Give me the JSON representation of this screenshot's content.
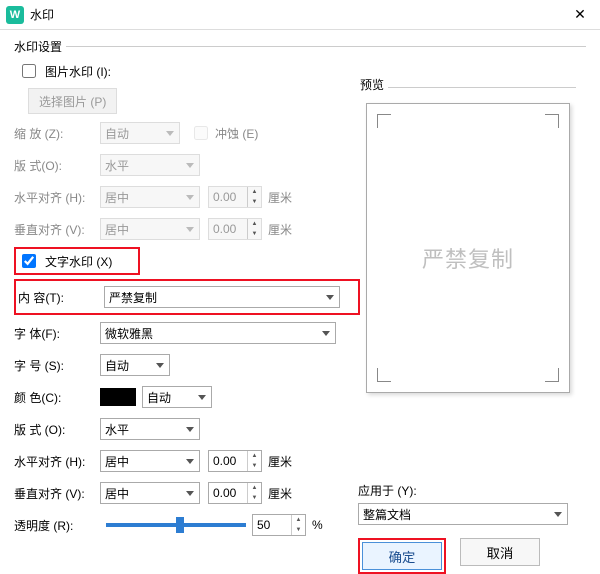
{
  "window": {
    "title": "水印",
    "close": "✕",
    "app_glyph": "W"
  },
  "settings_title": "水印设置",
  "image": {
    "checkbox_label": "图片水印 (I):",
    "select_button": "选择图片 (P)",
    "scale_label": "缩   放 (Z):",
    "scale_value": "自动",
    "erode_label": "冲蚀 (E)",
    "layout_label": "版   式(O):",
    "layout_value": "水平",
    "halign_label": "水平对齐 (H):",
    "halign_value": "居中",
    "halign_num": "0.00",
    "valign_label": "垂直对齐 (V):",
    "valign_value": "居中",
    "valign_num": "0.00",
    "unit": "厘米"
  },
  "text": {
    "checkbox_label": "文字水印 (X)",
    "content_label": "内   容(T):",
    "content_value": "严禁复制",
    "font_label": "字   体(F):",
    "font_value": "微软雅黑",
    "size_label": "字   号 (S):",
    "size_value": "自动",
    "color_label": "颜   色(C):",
    "color_value": "自动",
    "layout_label": "版   式 (O):",
    "layout_value": "水平",
    "halign_label": "水平对齐 (H):",
    "halign_value": "居中",
    "halign_num": "0.00",
    "valign_label": "垂直对齐 (V):",
    "valign_value": "居中",
    "valign_num": "0.00",
    "unit": "厘米",
    "opacity_label": "透明度 (R):",
    "opacity_value": "50",
    "opacity_unit": "%"
  },
  "preview": {
    "title": "预览",
    "watermark_text": "严禁复制"
  },
  "apply": {
    "label": "应用于 (Y):",
    "value": "整篇文档"
  },
  "footer": {
    "ok": "确定",
    "cancel": "取消"
  }
}
